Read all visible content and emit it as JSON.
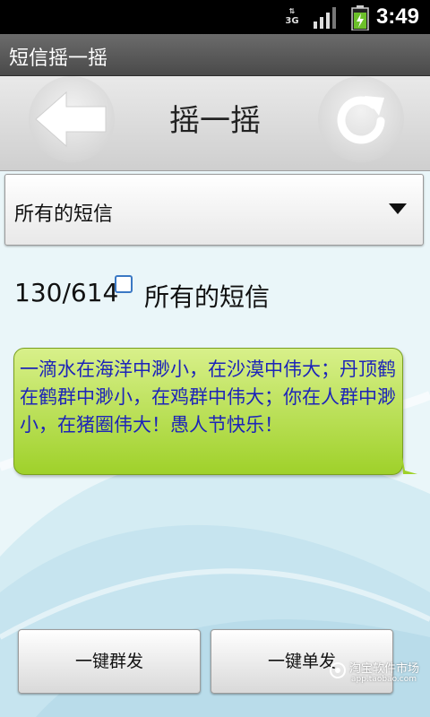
{
  "status_bar": {
    "network": "3G",
    "time": "3:49"
  },
  "app": {
    "title": "短信摇一摇"
  },
  "toolbar": {
    "title": "摇一摇",
    "back_icon": "back-arrow-icon",
    "refresh_icon": "refresh-icon"
  },
  "dropdown": {
    "selected": "所有的短信"
  },
  "counter": {
    "text": "130/614",
    "label": "所有的短信"
  },
  "message": {
    "text": "一滴水在海洋中渺小，在沙漠中伟大；丹顶鹤在鹤群中渺小，在鸡群中伟大；你在人群中渺小，在猪圈伟大！愚人节快乐！"
  },
  "buttons": {
    "group_send": "一键群发",
    "single_send": "一键单发"
  },
  "watermark": {
    "main": "淘宝软件市场",
    "sub": "app.taobao.com"
  },
  "colors": {
    "bubble_text": "#1d24b8",
    "bubble_green": "#9fd12a",
    "checkbox_blue": "#3a78c4"
  }
}
